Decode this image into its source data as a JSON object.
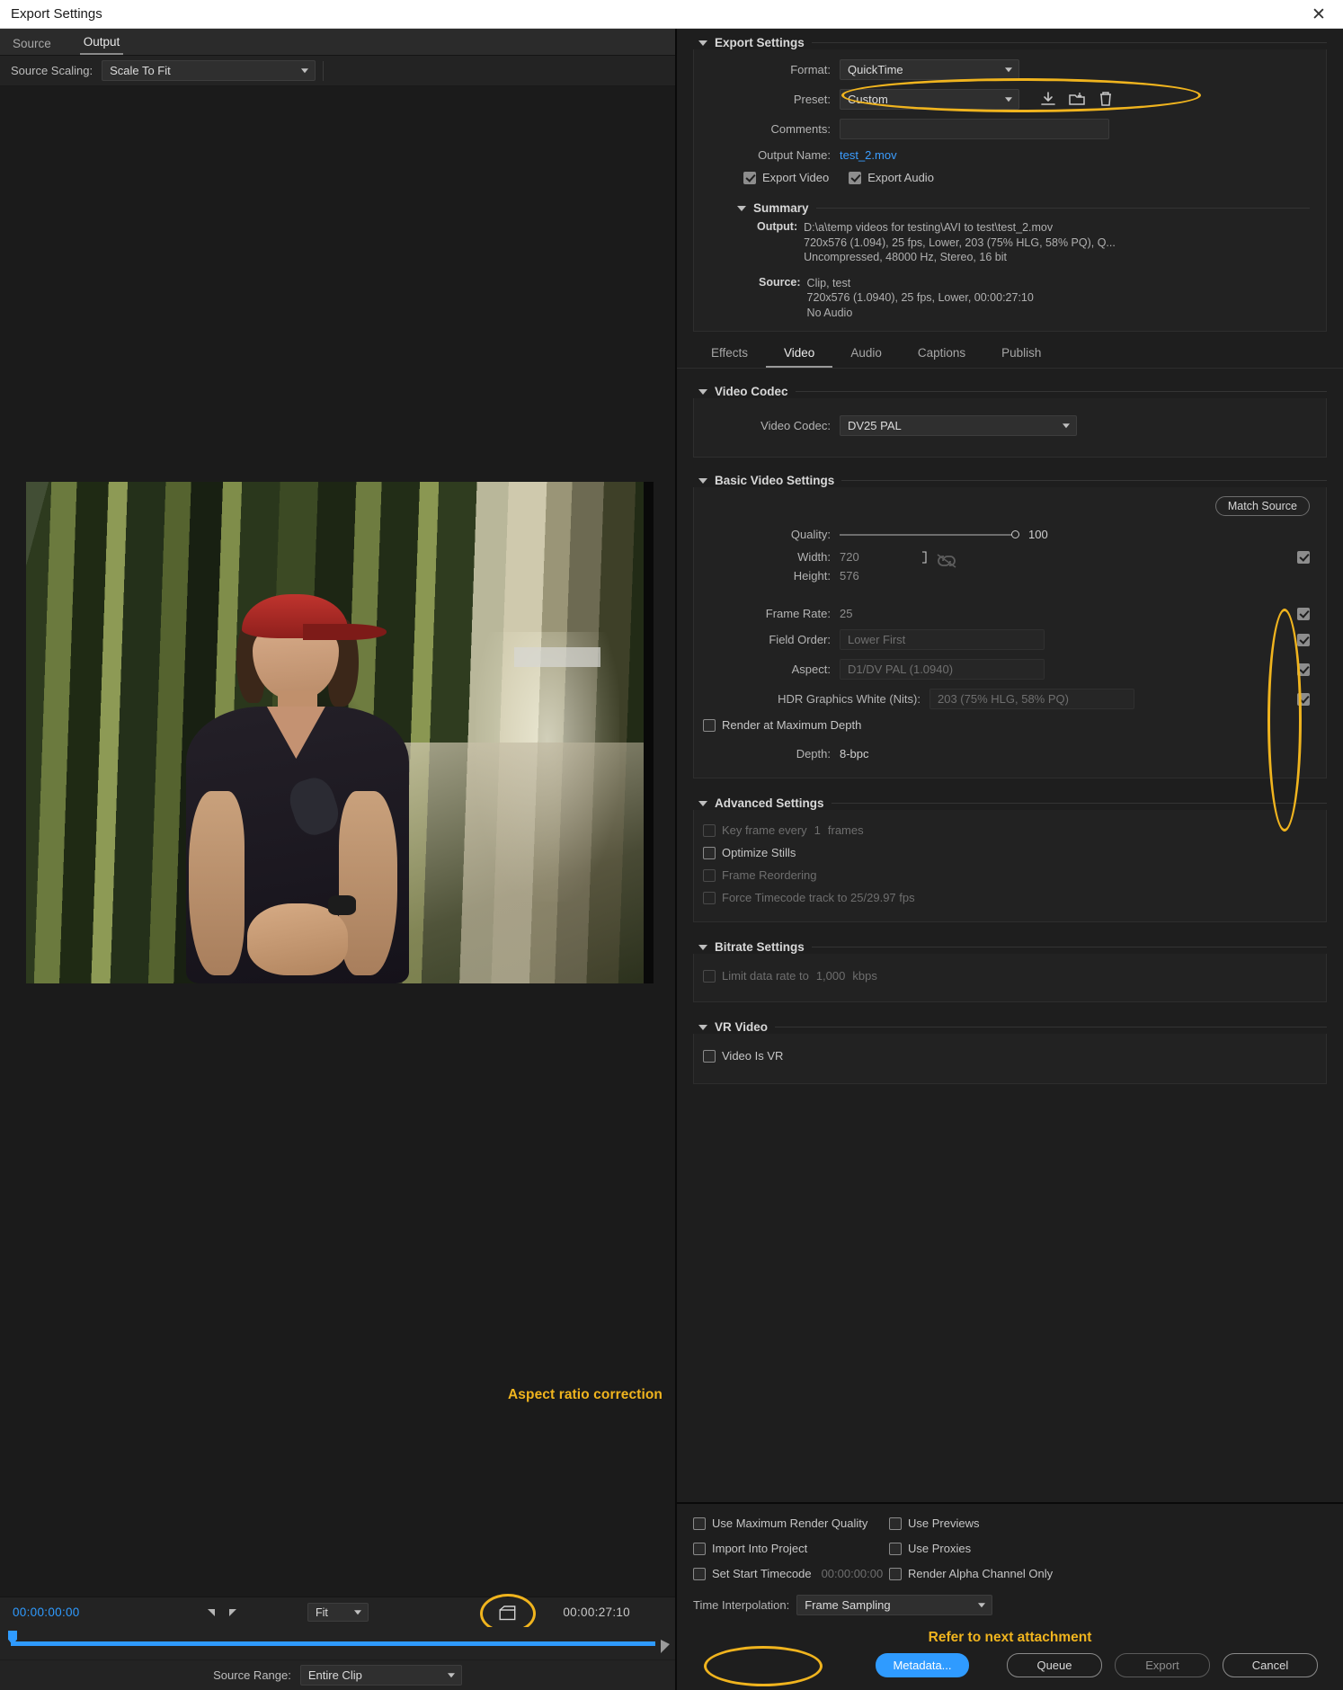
{
  "window": {
    "title": "Export Settings",
    "close_icon": "close-icon"
  },
  "left": {
    "tabs": [
      {
        "label": "Source",
        "active": false
      },
      {
        "label": "Output",
        "active": true
      }
    ],
    "source_scaling": {
      "label": "Source Scaling:",
      "value": "Scale To Fit"
    },
    "annotation_aspect": "Aspect ratio correction",
    "transport": {
      "current_time": "00:00:00:00",
      "duration": "00:00:27:10",
      "zoom_level": "Fit",
      "aspect_button_icon": "aspect-ratio-correction-icon",
      "in_marker_icon": "in-point-icon",
      "out_marker_icon": "out-point-icon"
    },
    "source_range": {
      "label": "Source Range:",
      "value": "Entire Clip"
    }
  },
  "right": {
    "export_settings": {
      "title": "Export Settings",
      "format": {
        "label": "Format:",
        "value": "QuickTime"
      },
      "preset": {
        "label": "Preset:",
        "value": "Custom"
      },
      "preset_icons": [
        "save-preset-icon",
        "import-preset-icon",
        "delete-preset-icon"
      ],
      "comments": {
        "label": "Comments:",
        "value": ""
      },
      "output_name": {
        "label": "Output Name:",
        "value": "test_2.mov"
      },
      "export_video": {
        "label": "Export Video",
        "checked": true
      },
      "export_audio": {
        "label": "Export Audio",
        "checked": true
      },
      "summary": {
        "title": "Summary",
        "output_key": "Output:",
        "output_lines": [
          "D:\\a\\temp videos for testing\\AVI to test\\test_2.mov",
          "720x576 (1.094), 25 fps, Lower, 203 (75% HLG, 58% PQ), Q...",
          "Uncompressed, 48000 Hz, Stereo, 16 bit"
        ],
        "source_key": "Source:",
        "source_lines": [
          "Clip, test",
          "720x576 (1.0940), 25 fps, Lower, 00:00:27:10",
          "No Audio"
        ]
      }
    },
    "tabs": [
      {
        "label": "Effects",
        "active": false
      },
      {
        "label": "Video",
        "active": true
      },
      {
        "label": "Audio",
        "active": false
      },
      {
        "label": "Captions",
        "active": false
      },
      {
        "label": "Publish",
        "active": false
      }
    ],
    "video_codec": {
      "title": "Video Codec",
      "field": {
        "label": "Video Codec:",
        "value": "DV25 PAL"
      }
    },
    "basic_video": {
      "title": "Basic Video Settings",
      "match_source": "Match Source",
      "quality": {
        "label": "Quality:",
        "value": "100"
      },
      "width": {
        "label": "Width:",
        "value": "720",
        "checked": true
      },
      "height": {
        "label": "Height:",
        "value": "576"
      },
      "frame_rate": {
        "label": "Frame Rate:",
        "value": "25",
        "checked": true
      },
      "field_order": {
        "label": "Field Order:",
        "value": "Lower First",
        "checked": true
      },
      "aspect": {
        "label": "Aspect:",
        "value": "D1/DV PAL (1.0940)",
        "checked": true
      },
      "hdr_white": {
        "label": "HDR Graphics White (Nits):",
        "value": "203 (75% HLG, 58% PQ)",
        "checked": true
      },
      "render_max_depth": {
        "label": "Render at Maximum Depth",
        "checked": false
      },
      "depth": {
        "label": "Depth:",
        "value": "8-bpc"
      },
      "link_icon": "link-dimensions-icon"
    },
    "advanced": {
      "title": "Advanced Settings",
      "key_frame": {
        "label_before": "Key frame every",
        "value": "1",
        "label_after": "frames",
        "checked": false
      },
      "optimize_stills": {
        "label": "Optimize Stills",
        "checked": false
      },
      "frame_reordering": {
        "label": "Frame Reordering",
        "checked": false
      },
      "force_timecode": {
        "label": "Force Timecode track to 25/29.97 fps",
        "checked": false
      }
    },
    "bitrate": {
      "title": "Bitrate Settings",
      "limit_rate": {
        "label_before": "Limit data rate to",
        "value": "1,000",
        "label_after": "kbps",
        "checked": false
      }
    },
    "vr": {
      "title": "VR Video",
      "video_is_vr": {
        "label": "Video Is VR",
        "checked": false
      }
    }
  },
  "bottom": {
    "checks_left": [
      {
        "label": "Use Maximum Render Quality",
        "checked": false
      },
      {
        "label": "Import Into Project",
        "checked": false
      },
      {
        "label": "Set Start Timecode",
        "checked": false,
        "value": "00:00:00:00"
      }
    ],
    "checks_right": [
      {
        "label": "Use Previews",
        "checked": false
      },
      {
        "label": "Use Proxies",
        "checked": false
      },
      {
        "label": "Render Alpha Channel Only",
        "checked": false
      }
    ],
    "time_interpolation": {
      "label": "Time Interpolation:",
      "value": "Frame Sampling"
    },
    "annotation_refer": "Refer to next attachment",
    "buttons": [
      {
        "label": "Metadata...",
        "style": "primary"
      },
      {
        "label": "Queue",
        "style": "ghost"
      },
      {
        "label": "Export",
        "style": "ghost-dim"
      },
      {
        "label": "Cancel",
        "style": "ghost"
      }
    ]
  },
  "colors": {
    "accent_blue": "#2f9bff",
    "highlight_yellow": "#f0b41e",
    "panel_bg": "#1e1e1e"
  }
}
